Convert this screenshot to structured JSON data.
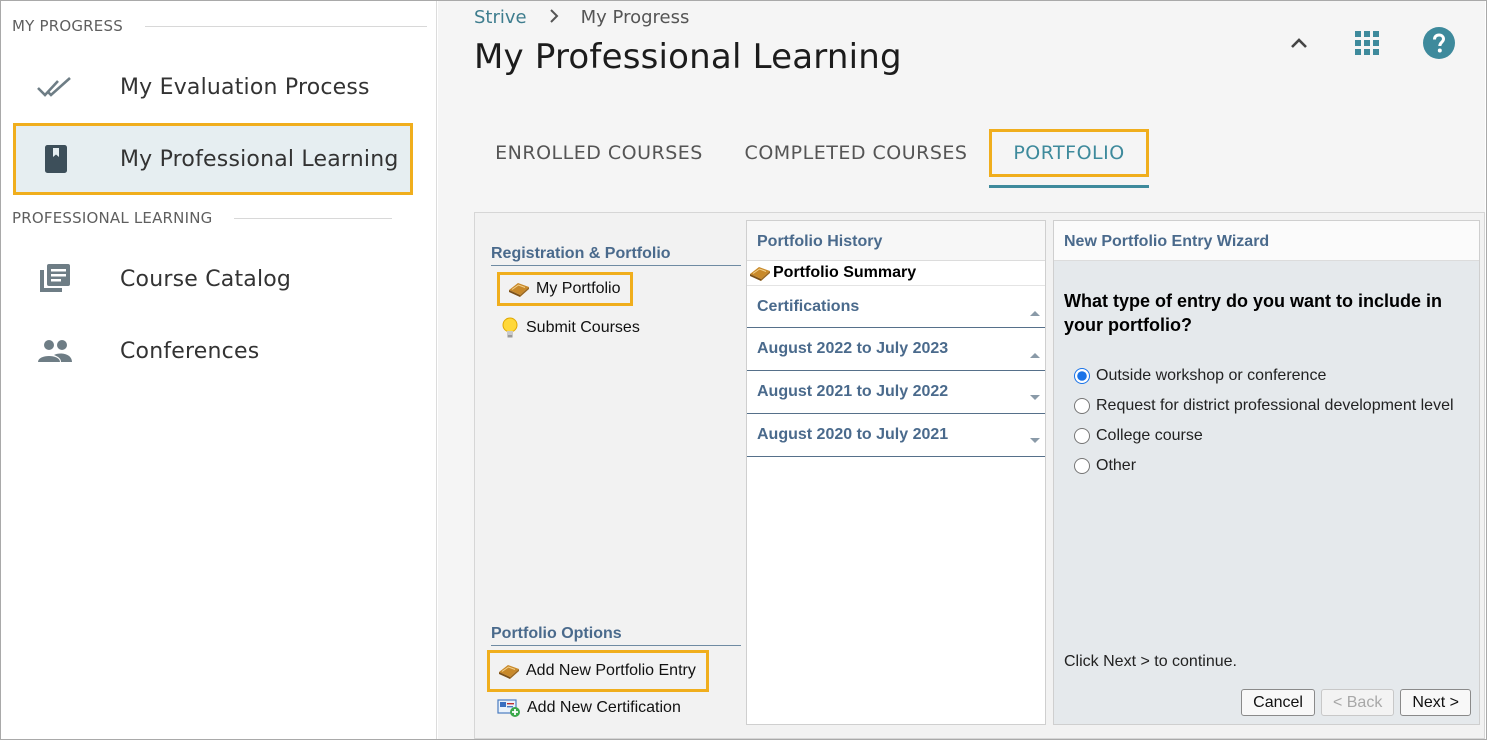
{
  "sidebar": {
    "sections": [
      {
        "title": "MY PROGRESS"
      },
      {
        "title": "PROFESSIONAL LEARNING"
      }
    ],
    "items": [
      {
        "label": "My Evaluation Process",
        "icon": "double-check-icon"
      },
      {
        "label": "My Professional Learning",
        "icon": "book-icon",
        "active": true
      },
      {
        "label": "Course Catalog",
        "icon": "catalog-icon"
      },
      {
        "label": "Conferences",
        "icon": "people-icon"
      }
    ]
  },
  "header": {
    "breadcrumb": {
      "root": "Strive",
      "current": "My Progress"
    },
    "title": "My Professional Learning",
    "icons": [
      "chevron-up-icon",
      "apps-grid-icon",
      "help-icon"
    ]
  },
  "tabs": [
    {
      "label": "ENROLLED COURSES"
    },
    {
      "label": "COMPLETED COURSES"
    },
    {
      "label": "PORTFOLIO",
      "active": true
    }
  ],
  "panel": {
    "left": {
      "registration_head": "Registration & Portfolio",
      "my_portfolio": "My Portfolio",
      "submit_courses": "Submit Courses",
      "options_head": "Portfolio Options",
      "add_entry": "Add New Portfolio Entry",
      "add_cert": "Add New Certification"
    },
    "history": {
      "head": "Portfolio History",
      "summary": "Portfolio Summary",
      "rows": [
        {
          "label": "Certifications",
          "state": "expanded"
        },
        {
          "label": "August 2022 to July 2023",
          "state": "expanded"
        },
        {
          "label": "August 2021 to July 2022",
          "state": "collapsed"
        },
        {
          "label": "August 2020 to July 2021",
          "state": "collapsed"
        }
      ]
    },
    "wizard": {
      "head": "New Portfolio Entry Wizard",
      "question": "What type of entry do you want to include in your portfolio?",
      "options": [
        {
          "label": "Outside workshop or conference",
          "checked": true
        },
        {
          "label": "Request for district professional development level",
          "checked": false
        },
        {
          "label": "College course",
          "checked": false
        },
        {
          "label": "Other",
          "checked": false
        }
      ],
      "hint": "Click Next > to continue.",
      "buttons": {
        "cancel": "Cancel",
        "back": "< Back",
        "next": "Next >"
      }
    }
  },
  "colors": {
    "accent": "#3e8a9c",
    "highlight": "#f0ae1d",
    "link_blue": "#4a6a8c",
    "icon_dark": "#3d4f5a"
  }
}
